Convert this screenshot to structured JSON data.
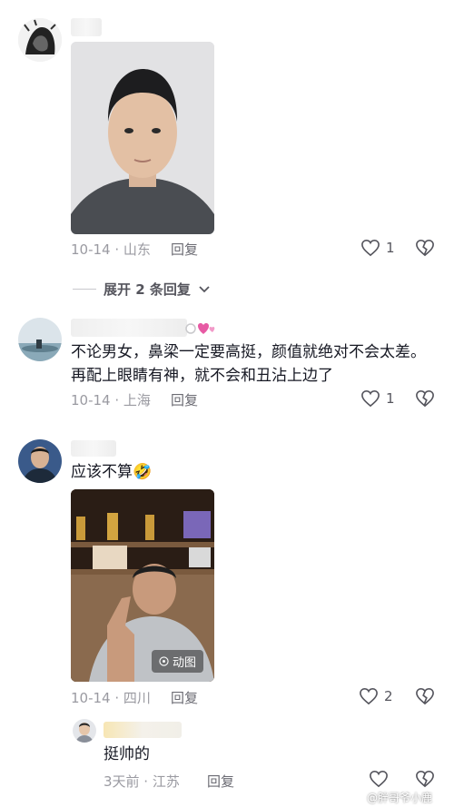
{
  "comments": [
    {
      "username": "",
      "text": "",
      "meta": "10-14 · 山东",
      "reply_label": "回复",
      "likes": "1",
      "has_photo": true
    },
    {
      "username": "",
      "text": "不论男女，鼻梁一定要高挺，颜值就绝对不会太差。再配上眼睛有神，就不会和丑沾上边了",
      "meta": "10-14 · 上海",
      "reply_label": "回复",
      "likes": "1"
    },
    {
      "username": "",
      "text": "应该不算",
      "emoji": "🤣",
      "meta": "10-14 · 四川",
      "reply_label": "回复",
      "likes": "2",
      "photo_badge": "动图"
    }
  ],
  "expand_replies": "展开 2 条回复",
  "sub_reply": {
    "username": "",
    "text": "挺帅的",
    "meta": "3天前 · 江苏",
    "reply_label": "回复"
  },
  "watermark": "@胖哥爷小鹿",
  "colors": {
    "meta": "#9a9aa1",
    "text": "#161823"
  }
}
